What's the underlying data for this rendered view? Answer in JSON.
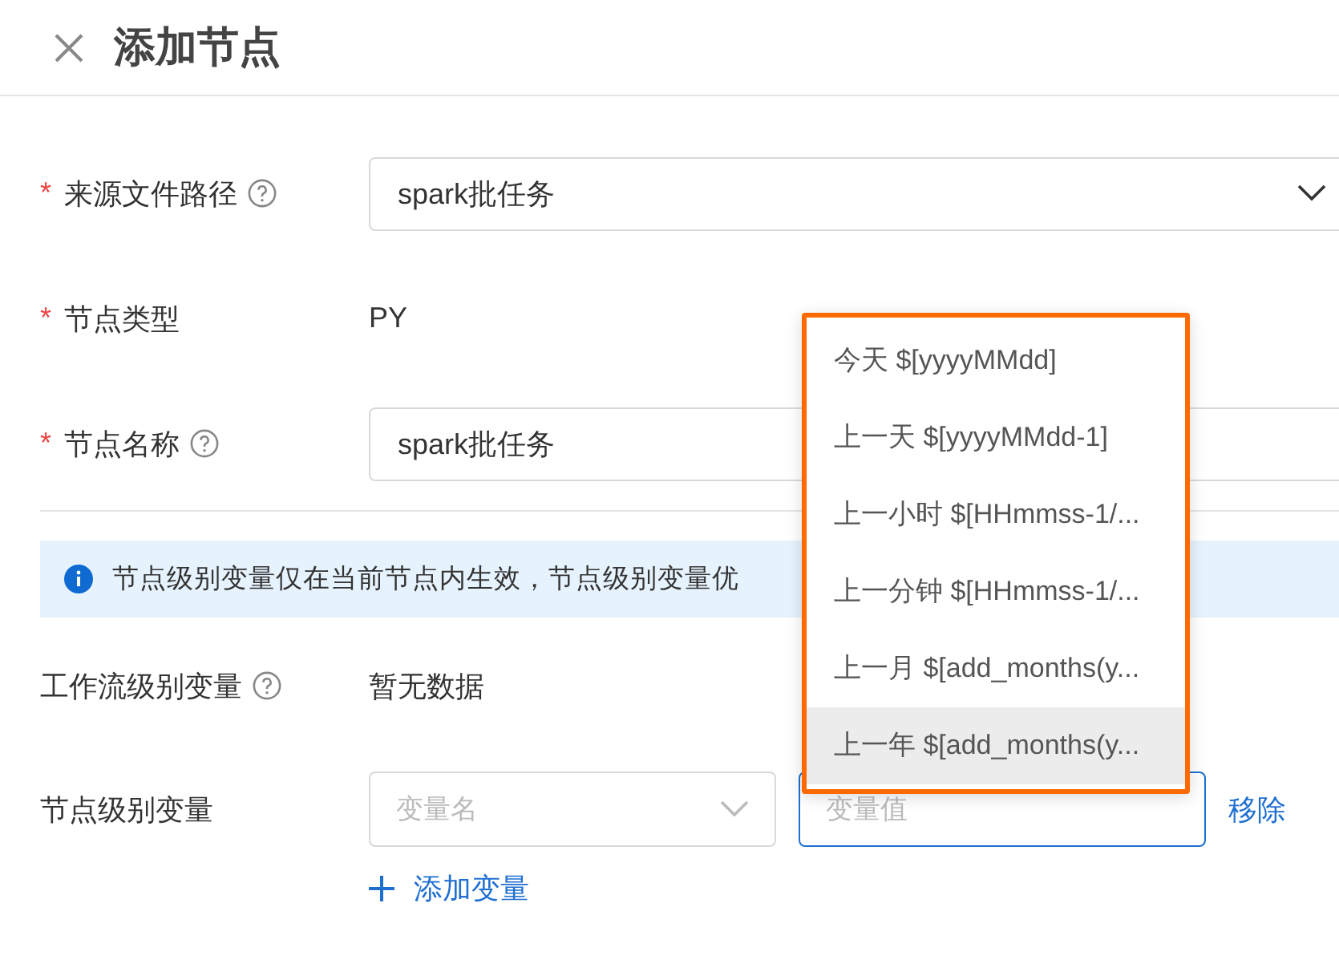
{
  "header": {
    "title": "添加节点"
  },
  "fields": [
    {
      "kind": "select",
      "required_mark": "*",
      "label": "来源文件路径",
      "help": true,
      "value": "spark批任务"
    },
    {
      "kind": "text",
      "required_mark": "*",
      "label": "节点类型",
      "help": false,
      "value": "PY"
    },
    {
      "kind": "input",
      "required_mark": "*",
      "label": "节点名称",
      "help": true,
      "value": "spark批任务"
    }
  ],
  "info_banner": {
    "text": "节点级别变量仅在当前节点内生效，节点级别变量优"
  },
  "workflow_variables": {
    "label": "工作流级别变量",
    "help": true,
    "empty_text": "暂无数据"
  },
  "node_variables": {
    "label": "节点级别变量",
    "rows": [
      {
        "name_placeholder": "变量名",
        "value_placeholder": "变量值",
        "focused": true,
        "remove_link": "移除"
      }
    ],
    "add_button": "添加变量"
  },
  "dropdown": {
    "items": [
      {
        "label": "今天 $[yyyyMMdd]",
        "selected": false
      },
      {
        "label": "上一天 $[yyyyMMdd-1]",
        "selected": false
      },
      {
        "label": "上一小时 $[HHmmss-1/...",
        "selected": false
      },
      {
        "label": "上一分钟 $[HHmmss-1/...",
        "selected": false
      },
      {
        "label": "上一月 $[add_months(y...",
        "selected": false
      },
      {
        "label": "上一年 $[add_months(y...",
        "selected": true
      }
    ]
  }
}
